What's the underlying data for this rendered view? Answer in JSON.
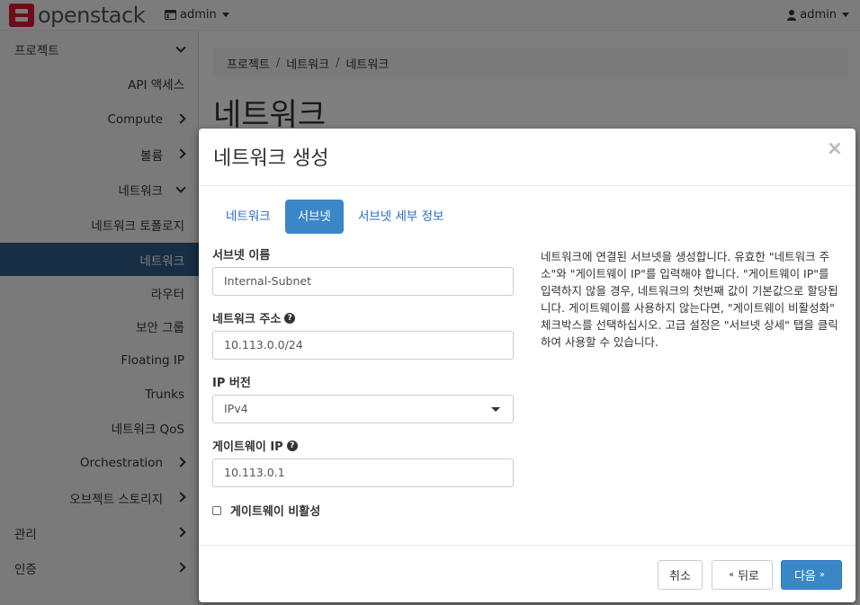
{
  "topbar": {
    "logo_text": "openstack",
    "project_menu": "admin",
    "user_menu": "admin"
  },
  "sidebar": {
    "items": [
      {
        "label": "프로젝트"
      },
      {
        "label": "API 액세스"
      },
      {
        "label": "Compute"
      },
      {
        "label": "볼륨"
      },
      {
        "label": "네트워크"
      },
      {
        "label": "네트워크 토폴로지"
      },
      {
        "label": "네트워크"
      },
      {
        "label": "라우터"
      },
      {
        "label": "보안 그룹"
      },
      {
        "label": "Floating IP"
      },
      {
        "label": "Trunks"
      },
      {
        "label": "네트워크 QoS"
      },
      {
        "label": "Orchestration"
      },
      {
        "label": "오브젝트 스토리지"
      },
      {
        "label": "관리"
      },
      {
        "label": "인증"
      }
    ]
  },
  "breadcrumb": [
    "프로젝트",
    "네트워크",
    "네트워크"
  ],
  "page_title": "네트워크",
  "modal": {
    "title": "네트워크 생성",
    "close": "×",
    "tabs": [
      "네트워크",
      "서브넷",
      "서브넷 세부 정보"
    ],
    "active_tab": "서브넷",
    "fields": {
      "subnet_name": {
        "label": "서브넷 이름",
        "value": "Internal-Subnet"
      },
      "network_address": {
        "label": "네트워크 주소",
        "value": "10.113.0.0/24"
      },
      "ip_version": {
        "label": "IP 버전",
        "value": "IPv4"
      },
      "gateway_ip": {
        "label": "게이트웨이 IP",
        "value": "10.113.0.1"
      },
      "disable_gateway": {
        "label": "게이트웨이 비활성",
        "checked": false
      }
    },
    "help_text": "네트워크에 연결된 서브넷을 생성합니다. 유효한 \"네트워크 주소\"와 \"게이트웨이 IP\"를 입력해야 합니다. \"게이트웨이 IP\"를 입력하지 않을 경우, 네트워크의 첫번째 값이 기본값으로 할당됩니다. 게이트웨이를 사용하지 않는다면, \"게이트웨이 비활성화\" 체크박스를 선택하십시오. 고급 설정은 \"서브넷 상세\" 탭을 클릭하여 사용할 수 있습니다.",
    "footer": {
      "cancel": "취소",
      "back": "뒤로",
      "next": "다음"
    }
  }
}
